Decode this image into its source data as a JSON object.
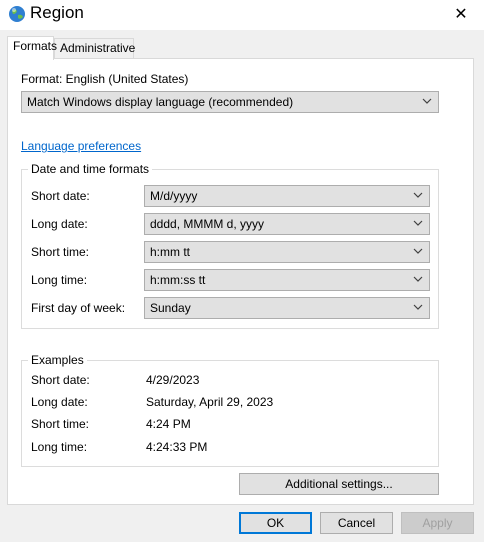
{
  "window": {
    "title": "Region",
    "close_glyph": "✕",
    "title_icon": "globe-icon"
  },
  "tabs": [
    {
      "label": "Formats",
      "active": true
    },
    {
      "label": "Administrative",
      "active": false
    }
  ],
  "format": {
    "label": "Format: English (United States)",
    "selected": "Match Windows display language (recommended)"
  },
  "language_preferences_link": "Language preferences",
  "date_time_formats": {
    "title": "Date and time formats",
    "rows": [
      {
        "label": "Short date:",
        "value": "M/d/yyyy"
      },
      {
        "label": "Long date:",
        "value": "dddd, MMMM d, yyyy"
      },
      {
        "label": "Short time:",
        "value": "h:mm tt"
      },
      {
        "label": "Long time:",
        "value": "h:mm:ss tt"
      },
      {
        "label": "First day of week:",
        "value": "Sunday"
      }
    ]
  },
  "examples": {
    "title": "Examples",
    "rows": [
      {
        "label": "Short date:",
        "value": "4/29/2023"
      },
      {
        "label": "Long date:",
        "value": "Saturday, April 29, 2023"
      },
      {
        "label": "Short time:",
        "value": "4:24 PM"
      },
      {
        "label": "Long time:",
        "value": "4:24:33 PM"
      }
    ]
  },
  "additional_settings_label": "Additional settings...",
  "buttons": {
    "ok": "OK",
    "cancel": "Cancel",
    "apply": "Apply"
  },
  "colors": {
    "link": "#0066cc",
    "focus_border": "#0078d7"
  }
}
